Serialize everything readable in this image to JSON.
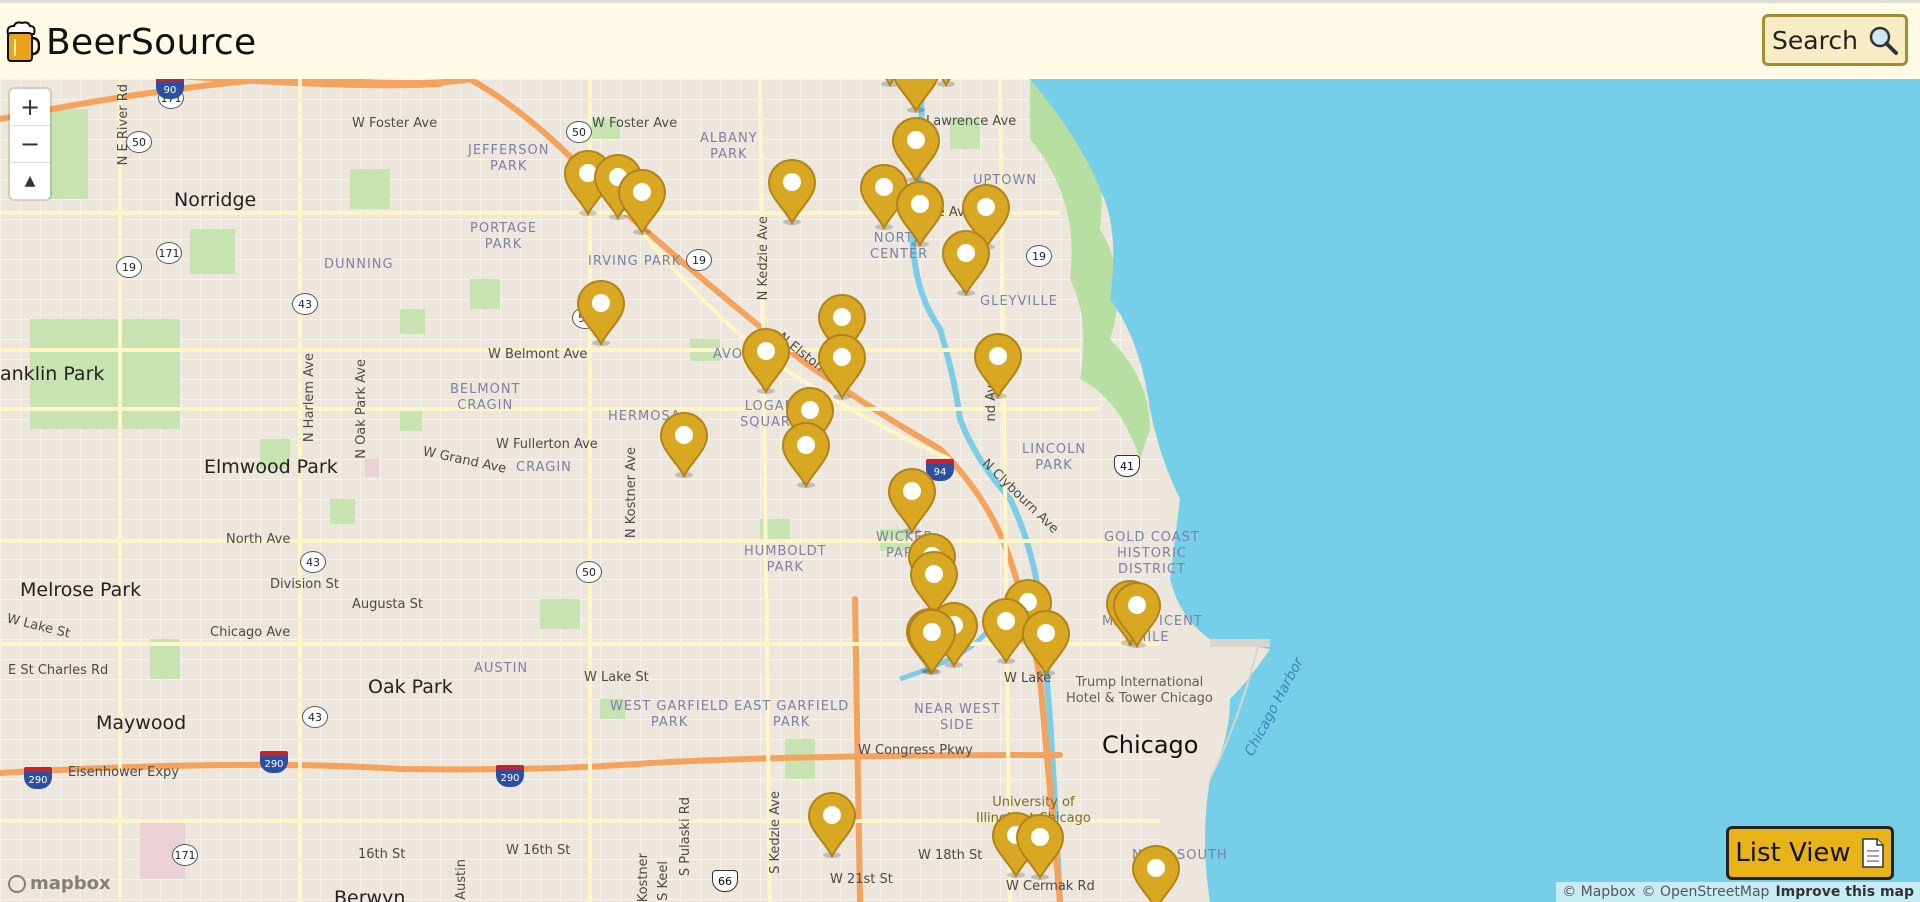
{
  "header": {
    "brand": "BeerSource",
    "search_label": "Search",
    "logo_icon": "beer-mug-icon",
    "search_icon": "magnifier-icon"
  },
  "map": {
    "zoom_in": "+",
    "zoom_out": "−",
    "compass": "▲",
    "places": {
      "norridge": "Norridge",
      "franklin_park": "anklin Park",
      "elmwood_park": "Elmwood Park",
      "melrose_park": "Melrose Park",
      "maywood": "Maywood",
      "oak_park": "Oak Park",
      "berwyn": "Berwyn",
      "chicago": "Chicago"
    },
    "districts": {
      "jefferson_park": "JEFFERSON\nPARK",
      "portage_park": "PORTAGE\nPARK",
      "dunning": "DUNNING",
      "irving_park": "IRVING PARK",
      "albany_park": "ALBANY\nPARK",
      "uptown": "UPTOWN",
      "north_center": "NORTH\nCENTER",
      "lakeview": "GLEYVILLE",
      "avondale": "AVONDALE",
      "belmont_cragin": "BELMONT\nCRAGIN",
      "hermosa": "HERMOSA",
      "logan_square": "LOGAN\nSQUARE",
      "cragin": "CRAGIN",
      "lincoln_park": "LINCOLN\nPARK",
      "wicker_park": "WICKER\nPARK",
      "humboldt_park": "HUMBOLDT\nPARK",
      "gold_coast": "GOLD COAST\nHISTORIC\nDISTRICT",
      "magnificent_mile": "MAGNIFICENT\nMILE",
      "austin": "AUSTIN",
      "west_garfield": "WEST GARFIELD\nPARK",
      "east_garfield": "EAST GARFIELD\nPARK",
      "near_west": "NEAR WEST\nSIDE",
      "near_south": "NEAR SOUTH"
    },
    "streets": {
      "w_foster_1": "W Foster Ave",
      "w_foster_2": "W Foster Ave",
      "w_belmont": "W Belmont Ave",
      "w_fullerton": "W Fullerton Ave",
      "w_grand": "W Grand Ave",
      "north_ave": "North Ave",
      "division": "Division St",
      "augusta": "Augusta St",
      "w_lake": "W Lake St",
      "chicago_ave": "Chicago Ave",
      "e_st_charles": "E St Charles Rd",
      "w_lake_2": "W Lake St",
      "eisenhower": "Eisenhower Expy",
      "congress": "W Congress Pkwy",
      "w_16th": "W 16th St",
      "16th": "16th St",
      "w_18th": "W 18th St",
      "w_21st": "W 21st St",
      "w_cermak": "W Cermak Rd",
      "n_elston": "N Elston",
      "n_clybourn": "N Clybourn Ave",
      "n_kedzie": "N Kedzie Ave",
      "n_kostner": "N Kostner Ave",
      "n_harlem": "N Harlem Ave",
      "n_oak_park": "N Oak Park Ave",
      "n_river": "N E River Rd",
      "s_pulaski": "S Pulaski Rd",
      "s_kedzie": "S Kedzie Ave",
      "s_kostner": "S Kostner",
      "s_keeler": "S Keel",
      "s_austin": "S Austin",
      "lawrence": "Lawrence Ave",
      "montrose": "se Ave",
      "ashland": "nd Ave",
      "w_lake_3": "W Lake",
      "lincoln": "ln Ave"
    },
    "pois": {
      "trump": "Trump International\nHotel & Tower Chicago",
      "uic": "University of\nIllinois at Chicago",
      "chicago_harbor": "Chicago Harbor"
    },
    "shields": [
      "171",
      "50",
      "90",
      "19",
      "171",
      "19",
      "43",
      "19",
      "41",
      "94",
      "43",
      "50",
      "43",
      "290",
      "290",
      "290",
      "171",
      "66",
      "50",
      "53"
    ],
    "attribution": {
      "mapbox": "© Mapbox",
      "osm": "© OpenStreetMap",
      "improve": "Improve this map"
    },
    "mapbox_logo": "mapbox",
    "pin_icon": "map-pin-icon"
  },
  "list_view_label": "List View",
  "colors": {
    "header_bg": "#fffbe6",
    "pin_fill": "#d9a823",
    "pin_stroke": "#b1831a",
    "water": "#75cfe8",
    "highway": "#f4a25c",
    "list_button": "#e8b318"
  }
}
